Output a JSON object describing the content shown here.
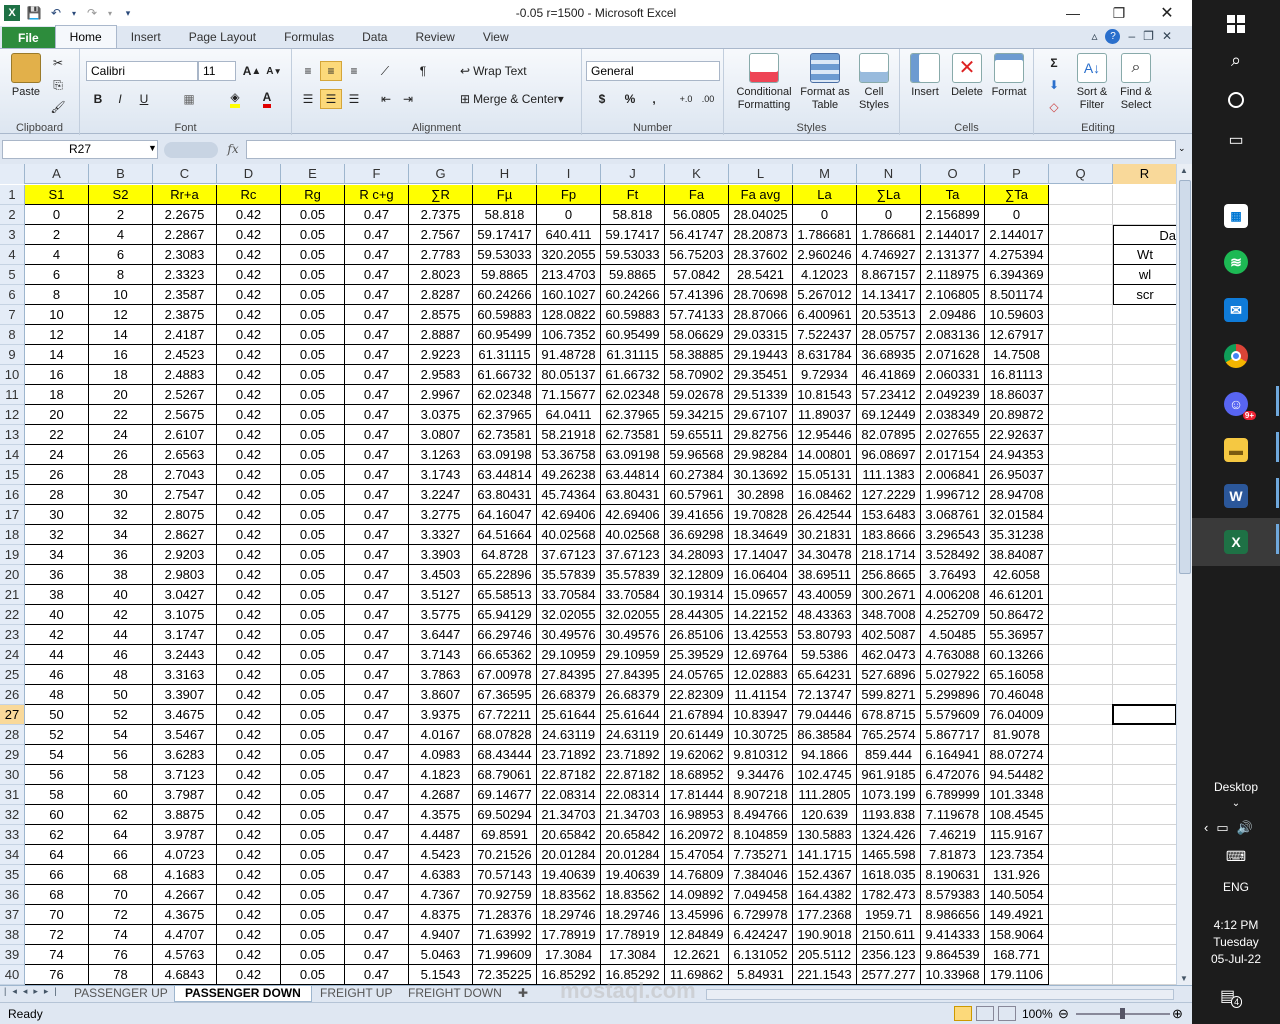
{
  "window": {
    "title": "-0.05  r=1500  -  Microsoft Excel",
    "minimize_icon": "minimize-icon",
    "restore_icon": "restore-icon",
    "close_icon": "close-icon"
  },
  "ribbon_tabs": [
    "File",
    "Home",
    "Insert",
    "Page Layout",
    "Formulas",
    "Data",
    "Review",
    "View"
  ],
  "ribbon": {
    "clipboard": {
      "label": "Clipboard",
      "paste": "Paste"
    },
    "font": {
      "label": "Font",
      "name": "Calibri",
      "size": "11",
      "bold": "B",
      "italic": "I",
      "underline": "U"
    },
    "alignment": {
      "label": "Alignment",
      "wrap": "Wrap Text",
      "merge": "Merge & Center"
    },
    "number": {
      "label": "Number",
      "format": "General",
      "currency": "$",
      "percent": "%",
      "comma": ","
    },
    "styles": {
      "label": "Styles",
      "conditional": "Conditional Formatting",
      "format_table": "Format as Table",
      "cell_styles": "Cell Styles"
    },
    "cells": {
      "label": "Cells",
      "insert": "Insert",
      "delete": "Delete",
      "format": "Format"
    },
    "editing": {
      "label": "Editing",
      "sort": "Sort & Filter",
      "find": "Find & Select",
      "sigma": "Σ"
    }
  },
  "formula_bar": {
    "name_box": "R27",
    "fx": "fx",
    "value": ""
  },
  "columns": [
    "A",
    "B",
    "C",
    "D",
    "E",
    "F",
    "G",
    "H",
    "I",
    "J",
    "K",
    "L",
    "M",
    "N",
    "O",
    "P",
    "Q",
    "R"
  ],
  "headers": [
    "S1",
    "S2",
    "Rr+a",
    "Rc",
    "Rg",
    "R c+g",
    "∑R",
    "Fµ",
    "Fp",
    "Ft",
    "Fa",
    "Fa avg",
    "La",
    "∑La",
    "Ta",
    "∑Ta"
  ],
  "rows": [
    [
      "0",
      "2",
      "2.2675",
      "0.42",
      "0.05",
      "0.47",
      "2.7375",
      "58.818",
      "0",
      "58.818",
      "56.0805",
      "28.04025",
      "0",
      "0",
      "2.156899",
      "0"
    ],
    [
      "2",
      "4",
      "2.2867",
      "0.42",
      "0.05",
      "0.47",
      "2.7567",
      "59.17417",
      "640.411",
      "59.17417",
      "56.41747",
      "28.20873",
      "1.786681",
      "1.786681",
      "2.144017",
      "2.144017"
    ],
    [
      "4",
      "6",
      "2.3083",
      "0.42",
      "0.05",
      "0.47",
      "2.7783",
      "59.53033",
      "320.2055",
      "59.53033",
      "56.75203",
      "28.37602",
      "2.960246",
      "4.746927",
      "2.131377",
      "4.275394"
    ],
    [
      "6",
      "8",
      "2.3323",
      "0.42",
      "0.05",
      "0.47",
      "2.8023",
      "59.8865",
      "213.4703",
      "59.8865",
      "57.0842",
      "28.5421",
      "4.12023",
      "8.867157",
      "2.118975",
      "6.394369"
    ],
    [
      "8",
      "10",
      "2.3587",
      "0.42",
      "0.05",
      "0.47",
      "2.8287",
      "60.24266",
      "160.1027",
      "60.24266",
      "57.41396",
      "28.70698",
      "5.267012",
      "14.13417",
      "2.106805",
      "8.501174"
    ],
    [
      "10",
      "12",
      "2.3875",
      "0.42",
      "0.05",
      "0.47",
      "2.8575",
      "60.59883",
      "128.0822",
      "60.59883",
      "57.74133",
      "28.87066",
      "6.400961",
      "20.53513",
      "2.09486",
      "10.59603"
    ],
    [
      "12",
      "14",
      "2.4187",
      "0.42",
      "0.05",
      "0.47",
      "2.8887",
      "60.95499",
      "106.7352",
      "60.95499",
      "58.06629",
      "29.03315",
      "7.522437",
      "28.05757",
      "2.083136",
      "12.67917"
    ],
    [
      "14",
      "16",
      "2.4523",
      "0.42",
      "0.05",
      "0.47",
      "2.9223",
      "61.31115",
      "91.48728",
      "61.31115",
      "58.38885",
      "29.19443",
      "8.631784",
      "36.68935",
      "2.071628",
      "14.7508"
    ],
    [
      "16",
      "18",
      "2.4883",
      "0.42",
      "0.05",
      "0.47",
      "2.9583",
      "61.66732",
      "80.05137",
      "61.66732",
      "58.70902",
      "29.35451",
      "9.72934",
      "46.41869",
      "2.060331",
      "16.81113"
    ],
    [
      "18",
      "20",
      "2.5267",
      "0.42",
      "0.05",
      "0.47",
      "2.9967",
      "62.02348",
      "71.15677",
      "62.02348",
      "59.02678",
      "29.51339",
      "10.81543",
      "57.23412",
      "2.049239",
      "18.86037"
    ],
    [
      "20",
      "22",
      "2.5675",
      "0.42",
      "0.05",
      "0.47",
      "3.0375",
      "62.37965",
      "64.0411",
      "62.37965",
      "59.34215",
      "29.67107",
      "11.89037",
      "69.12449",
      "2.038349",
      "20.89872"
    ],
    [
      "22",
      "24",
      "2.6107",
      "0.42",
      "0.05",
      "0.47",
      "3.0807",
      "62.73581",
      "58.21918",
      "62.73581",
      "59.65511",
      "29.82756",
      "12.95446",
      "82.07895",
      "2.027655",
      "22.92637"
    ],
    [
      "24",
      "26",
      "2.6563",
      "0.42",
      "0.05",
      "0.47",
      "3.1263",
      "63.09198",
      "53.36758",
      "63.09198",
      "59.96568",
      "29.98284",
      "14.00801",
      "96.08697",
      "2.017154",
      "24.94353"
    ],
    [
      "26",
      "28",
      "2.7043",
      "0.42",
      "0.05",
      "0.47",
      "3.1743",
      "63.44814",
      "49.26238",
      "63.44814",
      "60.27384",
      "30.13692",
      "15.05131",
      "111.1383",
      "2.006841",
      "26.95037"
    ],
    [
      "28",
      "30",
      "2.7547",
      "0.42",
      "0.05",
      "0.47",
      "3.2247",
      "63.80431",
      "45.74364",
      "63.80431",
      "60.57961",
      "30.2898",
      "16.08462",
      "127.2229",
      "1.996712",
      "28.94708"
    ],
    [
      "30",
      "32",
      "2.8075",
      "0.42",
      "0.05",
      "0.47",
      "3.2775",
      "64.16047",
      "42.69406",
      "42.69406",
      "39.41656",
      "19.70828",
      "26.42544",
      "153.6483",
      "3.068761",
      "32.01584"
    ],
    [
      "32",
      "34",
      "2.8627",
      "0.42",
      "0.05",
      "0.47",
      "3.3327",
      "64.51664",
      "40.02568",
      "40.02568",
      "36.69298",
      "18.34649",
      "30.21831",
      "183.8666",
      "3.296543",
      "35.31238"
    ],
    [
      "34",
      "36",
      "2.9203",
      "0.42",
      "0.05",
      "0.47",
      "3.3903",
      "64.8728",
      "37.67123",
      "37.67123",
      "34.28093",
      "17.14047",
      "34.30478",
      "218.1714",
      "3.528492",
      "38.84087"
    ],
    [
      "36",
      "38",
      "2.9803",
      "0.42",
      "0.05",
      "0.47",
      "3.4503",
      "65.22896",
      "35.57839",
      "35.57839",
      "32.12809",
      "16.06404",
      "38.69511",
      "256.8665",
      "3.76493",
      "42.6058"
    ],
    [
      "38",
      "40",
      "3.0427",
      "0.42",
      "0.05",
      "0.47",
      "3.5127",
      "65.58513",
      "33.70584",
      "33.70584",
      "30.19314",
      "15.09657",
      "43.40059",
      "300.2671",
      "4.006208",
      "46.61201"
    ],
    [
      "40",
      "42",
      "3.1075",
      "0.42",
      "0.05",
      "0.47",
      "3.5775",
      "65.94129",
      "32.02055",
      "32.02055",
      "28.44305",
      "14.22152",
      "48.43363",
      "348.7008",
      "4.252709",
      "50.86472"
    ],
    [
      "42",
      "44",
      "3.1747",
      "0.42",
      "0.05",
      "0.47",
      "3.6447",
      "66.29746",
      "30.49576",
      "30.49576",
      "26.85106",
      "13.42553",
      "53.80793",
      "402.5087",
      "4.50485",
      "55.36957"
    ],
    [
      "44",
      "46",
      "3.2443",
      "0.42",
      "0.05",
      "0.47",
      "3.7143",
      "66.65362",
      "29.10959",
      "29.10959",
      "25.39529",
      "12.69764",
      "59.5386",
      "462.0473",
      "4.763088",
      "60.13266"
    ],
    [
      "46",
      "48",
      "3.3163",
      "0.42",
      "0.05",
      "0.47",
      "3.7863",
      "67.00978",
      "27.84395",
      "27.84395",
      "24.05765",
      "12.02883",
      "65.64231",
      "527.6896",
      "5.027922",
      "65.16058"
    ],
    [
      "48",
      "50",
      "3.3907",
      "0.42",
      "0.05",
      "0.47",
      "3.8607",
      "67.36595",
      "26.68379",
      "26.68379",
      "22.82309",
      "11.41154",
      "72.13747",
      "599.8271",
      "5.299896",
      "70.46048"
    ],
    [
      "50",
      "52",
      "3.4675",
      "0.42",
      "0.05",
      "0.47",
      "3.9375",
      "67.72211",
      "25.61644",
      "25.61644",
      "21.67894",
      "10.83947",
      "79.04446",
      "678.8715",
      "5.579609",
      "76.04009"
    ],
    [
      "52",
      "54",
      "3.5467",
      "0.42",
      "0.05",
      "0.47",
      "4.0167",
      "68.07828",
      "24.63119",
      "24.63119",
      "20.61449",
      "10.30725",
      "86.38584",
      "765.2574",
      "5.867717",
      "81.9078"
    ],
    [
      "54",
      "56",
      "3.6283",
      "0.42",
      "0.05",
      "0.47",
      "4.0983",
      "68.43444",
      "23.71892",
      "23.71892",
      "19.62062",
      "9.810312",
      "94.1866",
      "859.444",
      "6.164941",
      "88.07274"
    ],
    [
      "56",
      "58",
      "3.7123",
      "0.42",
      "0.05",
      "0.47",
      "4.1823",
      "68.79061",
      "22.87182",
      "22.87182",
      "18.68952",
      "9.34476",
      "102.4745",
      "961.9185",
      "6.472076",
      "94.54482"
    ],
    [
      "58",
      "60",
      "3.7987",
      "0.42",
      "0.05",
      "0.47",
      "4.2687",
      "69.14677",
      "22.08314",
      "22.08314",
      "17.81444",
      "8.907218",
      "111.2805",
      "1073.199",
      "6.789999",
      "101.3348"
    ],
    [
      "60",
      "62",
      "3.8875",
      "0.42",
      "0.05",
      "0.47",
      "4.3575",
      "69.50294",
      "21.34703",
      "21.34703",
      "16.98953",
      "8.494766",
      "120.639",
      "1193.838",
      "7.119678",
      "108.4545"
    ],
    [
      "62",
      "64",
      "3.9787",
      "0.42",
      "0.05",
      "0.47",
      "4.4487",
      "69.8591",
      "20.65842",
      "20.65842",
      "16.20972",
      "8.104859",
      "130.5883",
      "1324.426",
      "7.46219",
      "115.9167"
    ],
    [
      "64",
      "66",
      "4.0723",
      "0.42",
      "0.05",
      "0.47",
      "4.5423",
      "70.21526",
      "20.01284",
      "20.01284",
      "15.47054",
      "7.735271",
      "141.1715",
      "1465.598",
      "7.81873",
      "123.7354"
    ],
    [
      "66",
      "68",
      "4.1683",
      "0.42",
      "0.05",
      "0.47",
      "4.6383",
      "70.57143",
      "19.40639",
      "19.40639",
      "14.76809",
      "7.384046",
      "152.4367",
      "1618.035",
      "8.190631",
      "131.926"
    ],
    [
      "68",
      "70",
      "4.2667",
      "0.42",
      "0.05",
      "0.47",
      "4.7367",
      "70.92759",
      "18.83562",
      "18.83562",
      "14.09892",
      "7.049458",
      "164.4382",
      "1782.473",
      "8.579383",
      "140.5054"
    ],
    [
      "70",
      "72",
      "4.3675",
      "0.42",
      "0.05",
      "0.47",
      "4.8375",
      "71.28376",
      "18.29746",
      "18.29746",
      "13.45996",
      "6.729978",
      "177.2368",
      "1959.71",
      "8.986656",
      "149.4921"
    ],
    [
      "72",
      "74",
      "4.4707",
      "0.42",
      "0.05",
      "0.47",
      "4.9407",
      "71.63992",
      "17.78919",
      "17.78919",
      "12.84849",
      "6.424247",
      "190.9018",
      "2150.611",
      "9.414333",
      "158.9064"
    ],
    [
      "74",
      "76",
      "4.5763",
      "0.42",
      "0.05",
      "0.47",
      "5.0463",
      "71.99609",
      "17.3084",
      "17.3084",
      "12.2621",
      "6.131052",
      "205.5112",
      "2356.123",
      "9.864539",
      "168.771"
    ],
    [
      "76",
      "78",
      "4.6843",
      "0.42",
      "0.05",
      "0.47",
      "5.1543",
      "72.35225",
      "16.85292",
      "16.85292",
      "11.69862",
      "5.84931",
      "221.1543",
      "2577.277",
      "10.33968",
      "179.1106"
    ]
  ],
  "side_labels": {
    "r3": "Da",
    "r4": "Wt",
    "r5": "wl",
    "r6": "scr"
  },
  "selected_cell": {
    "col": "R",
    "row": 27
  },
  "sheet_tabs": [
    "PASSENGER UP",
    "PASSENGER DOWN",
    "FREIGHT UP",
    "FREIGHT DOWN"
  ],
  "active_sheet": "PASSENGER DOWN",
  "status": {
    "ready": "Ready",
    "zoom": "100%"
  },
  "watermark": "mostaql.com",
  "taskbar": {
    "desktop_label": "Desktop",
    "language": "ENG",
    "time": "4:12 PM",
    "day": "Tuesday",
    "date": "05-Jul-22",
    "notifications": "4",
    "mail_badge": "9+"
  },
  "colors": {
    "header_yellow": "#ffff00",
    "excel_green": "#2d8c3c",
    "selection_orange": "#f9d99a"
  }
}
